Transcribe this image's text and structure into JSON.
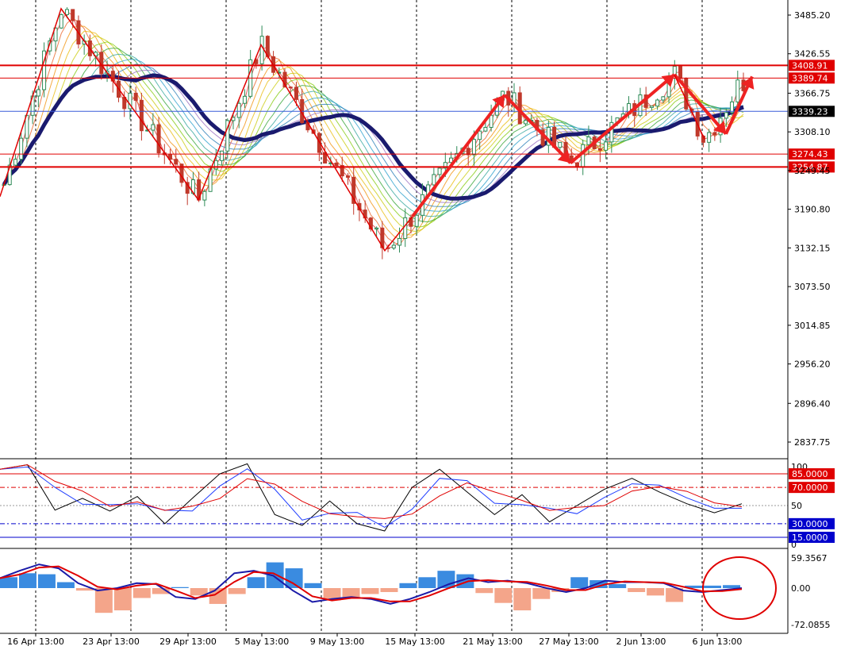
{
  "chart_data": {
    "type": "candlestick",
    "price_axis": {
      "ticks": [
        "3485.20",
        "3426.55",
        "3366.75",
        "3308.10",
        "3249.45",
        "3190.80",
        "3132.15",
        "3073.50",
        "3014.85",
        "2956.20",
        "2896.40",
        "2837.75"
      ],
      "range": [
        2805,
        3510
      ]
    },
    "price_levels": [
      {
        "label": "3408.91",
        "value": 3408.91,
        "color": "#e00000",
        "bold": true
      },
      {
        "label": "3389.74",
        "value": 3389.74,
        "color": "#e00000",
        "bold": false
      },
      {
        "label": "3339.23",
        "value": 3339.23,
        "color": "#000000",
        "bold": false
      },
      {
        "label": "3274.43",
        "value": 3274.43,
        "color": "#e00000",
        "bold": false
      },
      {
        "label": "3254.87",
        "value": 3254.87,
        "color": "#e00000",
        "bold": true
      }
    ],
    "time_axis": [
      "16 Apr 13:00",
      "23 Apr 13:00",
      "29 Apr 13:00",
      "5 May 13:00",
      "9 May 13:00",
      "15 May 13:00",
      "21 May 13:00",
      "27 May 13:00",
      "2 Jun 13:00",
      "6 Jun 13:00"
    ],
    "zigzag_prices": [
      3210,
      3495,
      3205,
      3440,
      3128,
      3364,
      3261,
      3395,
      3297,
      3385
    ],
    "moving_average_close": [
      3150,
      3300,
      3330,
      3320,
      3275,
      3290,
      3230,
      3215,
      3300,
      3320,
      3310,
      3352,
      3339
    ],
    "stochastic": {
      "axis_ticks": [
        "100",
        "50",
        "0"
      ],
      "levels": [
        {
          "label": "85.0000",
          "value": 85,
          "color": "#e00000"
        },
        {
          "label": "70.0000",
          "value": 70,
          "color": "#e00000"
        },
        {
          "label": "30.0000",
          "value": 30,
          "color": "#0000cc"
        },
        {
          "label": "15.0000",
          "value": 15,
          "color": "#0000cc"
        }
      ],
      "main_line": [
        90,
        95,
        45,
        58,
        44,
        60,
        30,
        58,
        85,
        96,
        40,
        28,
        55,
        30,
        22,
        70,
        90,
        65,
        40,
        62,
        32,
        50,
        68,
        80,
        65,
        52,
        42,
        52
      ]
    },
    "macd": {
      "axis_ticks": [
        "59.3567",
        "0.00",
        "-72.0855"
      ],
      "histogram": [
        22,
        30,
        28,
        12,
        -5,
        -50,
        -45,
        -20,
        -12,
        2,
        -15,
        -32,
        -12,
        22,
        52,
        40,
        10,
        -25,
        -20,
        -12,
        -8,
        10,
        22,
        35,
        28,
        -10,
        -30,
        -45,
        -22,
        -8,
        22,
        16,
        8,
        -8,
        -15,
        -28,
        5,
        5,
        6
      ],
      "main_line": [
        20,
        35,
        48,
        40,
        10,
        -5,
        0,
        10,
        8,
        -18,
        -22,
        -5,
        30,
        35,
        25,
        -5,
        -28,
        -22,
        -18,
        -22,
        -32,
        -22,
        -8,
        8,
        20,
        12,
        15,
        10,
        0,
        -8,
        0,
        15,
        12,
        12,
        10,
        -5,
        -8,
        -4,
        0
      ]
    }
  }
}
